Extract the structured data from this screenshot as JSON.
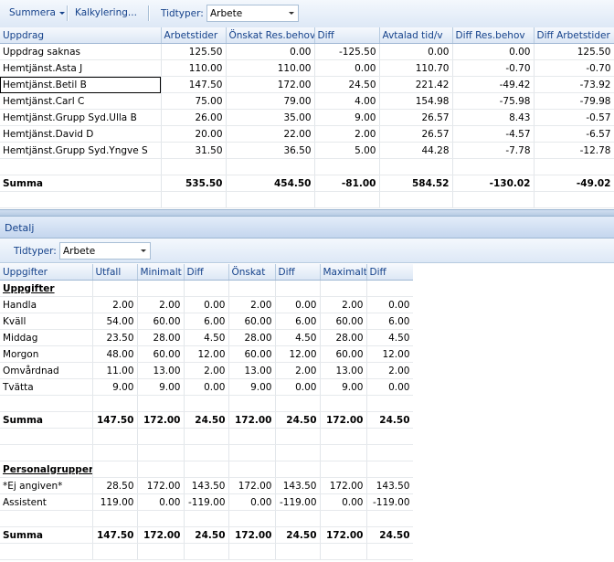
{
  "toolbar": {
    "summera_label": "Summera",
    "kalkylering_label": "Kalkylering...",
    "tidtyper_label": "Tidtyper:",
    "tidtyper_value": "Arbete"
  },
  "top_grid": {
    "columns": [
      "Uppdrag",
      "Arbetstider",
      "Önskat Res.behov",
      "Diff",
      "Avtalad tid/v",
      "Diff Res.behov",
      "Diff Arbetstider"
    ],
    "rows": [
      [
        "Uppdrag saknas",
        "125.50",
        "0.00",
        "-125.50",
        "0.00",
        "0.00",
        "125.50"
      ],
      [
        "Hemtjänst.Asta J",
        "110.00",
        "110.00",
        "0.00",
        "110.70",
        "-0.70",
        "-0.70"
      ],
      [
        "Hemtjänst.Betil B",
        "147.50",
        "172.00",
        "24.50",
        "221.42",
        "-49.42",
        "-73.92"
      ],
      [
        "Hemtjänst.Carl C",
        "75.00",
        "79.00",
        "4.00",
        "154.98",
        "-75.98",
        "-79.98"
      ],
      [
        "Hemtjänst.Grupp Syd.Ulla B",
        "26.00",
        "35.00",
        "9.00",
        "26.57",
        "8.43",
        "-0.57"
      ],
      [
        "Hemtjänst.David D",
        "20.00",
        "22.00",
        "2.00",
        "26.57",
        "-4.57",
        "-6.57"
      ],
      [
        "Hemtjänst.Grupp Syd.Yngve S",
        "31.50",
        "36.50",
        "5.00",
        "44.28",
        "-7.78",
        "-12.78"
      ]
    ],
    "sum": [
      "Summa",
      "535.50",
      "454.50",
      "-81.00",
      "584.52",
      "-130.02",
      "-49.02"
    ]
  },
  "detail": {
    "header": "Detalj",
    "tidtyper_label": "Tidtyper:",
    "tidtyper_value": "Arbete",
    "columns": [
      "Uppgifter",
      "Utfall",
      "Minimalt",
      "Diff",
      "Önskat",
      "Diff",
      "Maximalt",
      "Diff"
    ],
    "section1": {
      "title": "Uppgifter",
      "rows": [
        [
          "Handla",
          "2.00",
          "2.00",
          "0.00",
          "2.00",
          "0.00",
          "2.00",
          "0.00"
        ],
        [
          "Kväll",
          "54.00",
          "60.00",
          "6.00",
          "60.00",
          "6.00",
          "60.00",
          "6.00"
        ],
        [
          "Middag",
          "23.50",
          "28.00",
          "4.50",
          "28.00",
          "4.50",
          "28.00",
          "4.50"
        ],
        [
          "Morgon",
          "48.00",
          "60.00",
          "12.00",
          "60.00",
          "12.00",
          "60.00",
          "12.00"
        ],
        [
          "Omvårdnad",
          "11.00",
          "13.00",
          "2.00",
          "13.00",
          "2.00",
          "13.00",
          "2.00"
        ],
        [
          "Tvätta",
          "9.00",
          "9.00",
          "0.00",
          "9.00",
          "0.00",
          "9.00",
          "0.00"
        ]
      ],
      "sum": [
        "Summa",
        "147.50",
        "172.00",
        "24.50",
        "172.00",
        "24.50",
        "172.00",
        "24.50"
      ]
    },
    "section2": {
      "title": "Personalgrupper",
      "rows": [
        [
          "*Ej angiven*",
          "28.50",
          "172.00",
          "143.50",
          "172.00",
          "143.50",
          "172.00",
          "143.50"
        ],
        [
          "Assistent",
          "119.00",
          "0.00",
          "-119.00",
          "0.00",
          "-119.00",
          "0.00",
          "-119.00"
        ]
      ],
      "sum": [
        "Summa",
        "147.50",
        "172.00",
        "24.50",
        "172.00",
        "24.50",
        "172.00",
        "24.50"
      ]
    }
  },
  "colors": {
    "header_text": "#15428b",
    "toolbar_bg": "#dde8f6",
    "grid_line": "#e2e6ea"
  }
}
